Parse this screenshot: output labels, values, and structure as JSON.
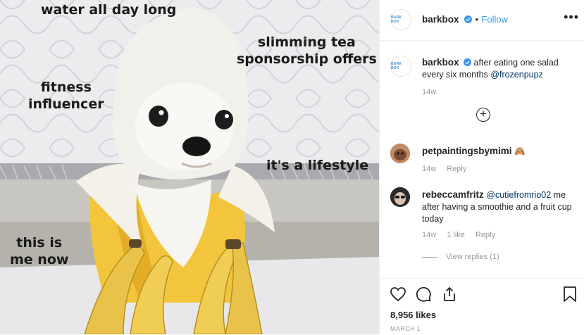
{
  "photo": {
    "meme_lines": {
      "line1": "water all day long",
      "line2a": "slimming tea",
      "line2b": "sponsorship offers",
      "line3a": "fitness",
      "line3b": "influencer",
      "line4": "it's a lifestyle",
      "line5a": "this is",
      "line5b": "me now"
    }
  },
  "header": {
    "avatar_text": "BARK BOX",
    "username": "barkbox",
    "separator": "•",
    "follow_label": "Follow",
    "more_icon": "more-options-icon"
  },
  "caption": {
    "username": "barkbox",
    "text": "after eating one salad every six months",
    "mention": "@frozenpupz",
    "time": "14w"
  },
  "load_more_icon": "plus-circle-icon",
  "comments": [
    {
      "username": "petpaintingsbymimi",
      "text": "",
      "emoji": "🙈",
      "time": "14w",
      "reply_label": "Reply"
    },
    {
      "username": "rebeccamfritz",
      "mention": "@cutiefromrio02",
      "text": "me after having a smoothie and a fruit cup today",
      "time": "14w",
      "likes": "1 like",
      "reply_label": "Reply",
      "view_replies": "View replies (1)"
    }
  ],
  "footer": {
    "like_icon": "heart-icon",
    "comment_icon": "comment-icon",
    "share_icon": "share-icon",
    "save_icon": "bookmark-icon",
    "likes": "8,956 likes",
    "date": "MARCH 1"
  },
  "colors": {
    "link_blue": "#3897f0",
    "mention": "#003569",
    "muted": "#999999",
    "banana": "#f2c53d"
  }
}
